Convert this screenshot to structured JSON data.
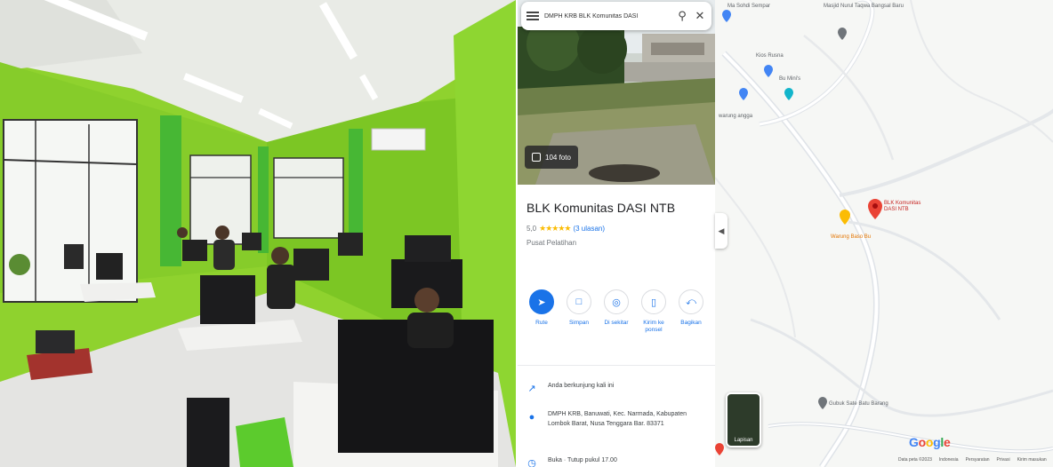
{
  "search": {
    "query": "DMPH KRB BLK Komunitas DASI",
    "menu_icon": "menu-icon",
    "search_icon": "search-icon",
    "close_icon": "close-icon"
  },
  "hero": {
    "photos_label": "104 foto"
  },
  "place": {
    "name": "BLK Komunitas DASI NTB",
    "rating": "5,0",
    "stars": "★★★★★",
    "reviews": "(3 ulasan)",
    "category": "Pusat Pelatihan"
  },
  "actions": [
    {
      "icon": "directions-icon",
      "label": "Rute"
    },
    {
      "icon": "save-icon",
      "label": "Simpan"
    },
    {
      "icon": "nearby-icon",
      "label": "Di sekitar"
    },
    {
      "icon": "send-to-phone-icon",
      "label": "Kirim ke ponsel"
    },
    {
      "icon": "share-icon",
      "label": "Bagikan"
    }
  ],
  "details": {
    "trend": "Anda berkunjung kali ini",
    "address": "DMPH KRB, Banuwati, Kec. Narmada, Kabupaten Lombok Barat, Nusa Tenggara Bar. 83371",
    "hours": "Buka · Tutup pukul 17.00"
  },
  "map": {
    "labels": {
      "top_left": "Ma Sohdi Sempar",
      "top_right": "Masjid Nurul Taqwa Bangsal Baru",
      "shop": "Kios Rusna",
      "cafe": "Bu Mini's",
      "food": "warung angga",
      "blk": "BLK Komunitas DASI NTB",
      "school": "Warung Baso Bu",
      "bottom": "Gubuk Sate Batu Barang"
    },
    "layer_label": "Lapisan",
    "google": "Google",
    "footer": [
      "Data peta ©2023",
      "Indonesia",
      "Persyaratan",
      "Privasi",
      "Kirim masukan"
    ],
    "colors": {
      "blue_pin": "#4285f4",
      "red_pin": "#ea4335",
      "orange_pin": "#fbbc04",
      "teal_pin": "#12b5cb",
      "gray_pin": "#70757a"
    }
  }
}
